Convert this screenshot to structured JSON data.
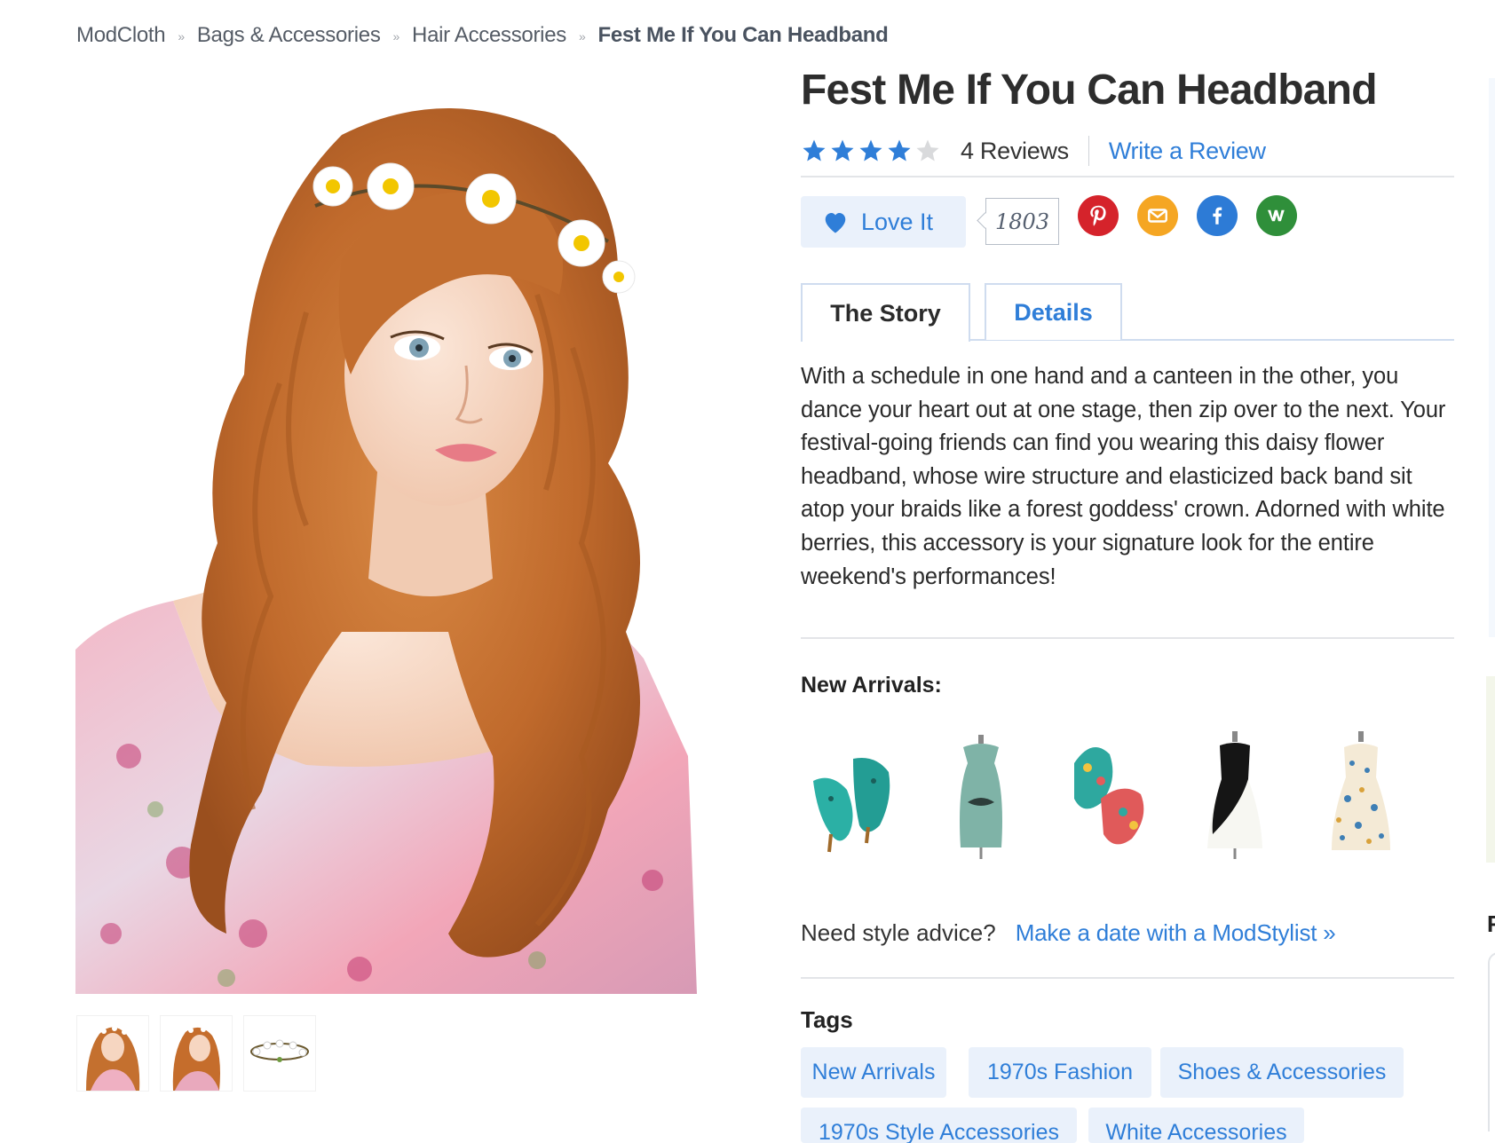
{
  "breadcrumb": {
    "items": [
      "ModCloth",
      "Bags & Accessories",
      "Hair Accessories"
    ],
    "current": "Fest Me If You Can Headband",
    "separator": "»"
  },
  "product": {
    "title": "Fest Me If You Can Headband",
    "rating": 4,
    "rating_max": 5,
    "reviews_label": "4 Reviews",
    "write_review_label": "Write a Review",
    "love_label": "Love It",
    "love_count": "1803"
  },
  "social": [
    "pinterest-icon",
    "email-icon",
    "facebook-icon",
    "wanelo-icon"
  ],
  "colors": {
    "link": "#2f7ed8",
    "star": "#2f7ed8",
    "pinterest": "#d5232b",
    "email": "#f5a623",
    "facebook": "#2d7bd6",
    "wanelo": "#2f8f3a",
    "tag_bg": "#eaf1fb"
  },
  "tabs": [
    {
      "label": "The Story",
      "active": true
    },
    {
      "label": "Details",
      "active": false
    }
  ],
  "story_text": "With a schedule in one hand and a canteen in the other, you dance your heart out at one stage, then zip over to the next. Your festival-going friends can find you wearing this daisy flower headband, whose wire structure and elasticized back band sit atop your braids like a forest goddess' crown. Adorned with white berries, this accessory is your signature look for the entire weekend's performances!",
  "new_arrivals": {
    "title": "New Arrivals:",
    "items": [
      "teal-flats",
      "teal-tank-top",
      "floral-sandals",
      "black-white-dress",
      "floral-print-dress"
    ]
  },
  "style_advice": {
    "question": "Need style advice?",
    "link": "Make a date with a ModStylist »"
  },
  "tags": {
    "title": "Tags",
    "items": [
      "New Arrivals",
      "1970s Fashion",
      "Shoes & Accessories",
      "1970s Style Accessories",
      "White Accessories"
    ]
  },
  "edge_fragment": "F"
}
